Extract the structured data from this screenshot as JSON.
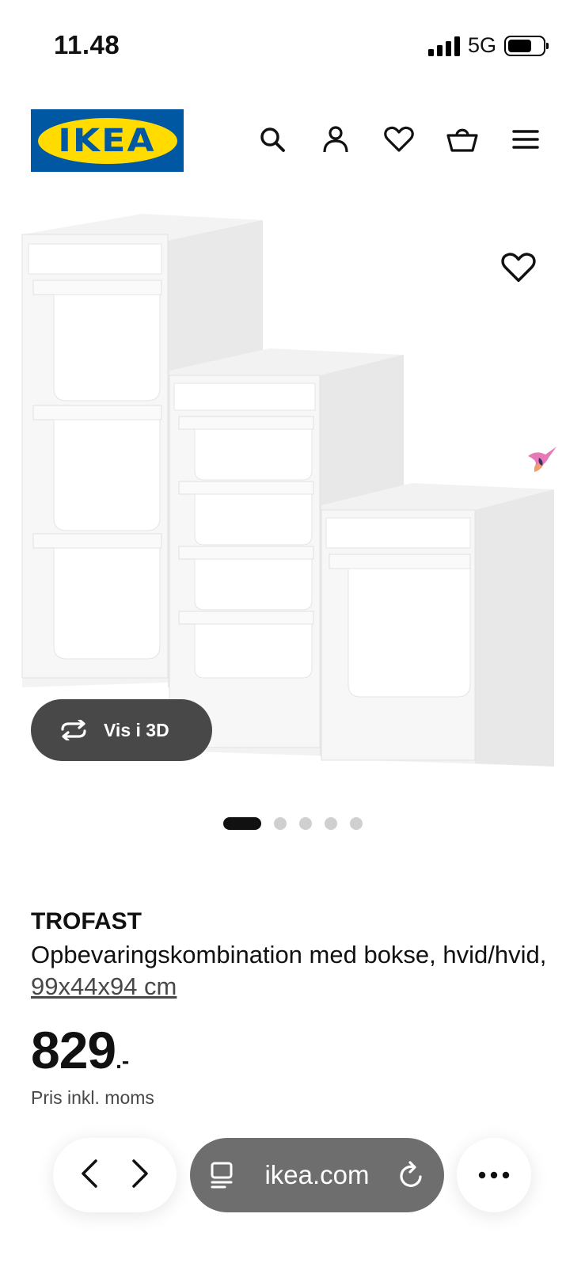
{
  "status_bar": {
    "time": "11.48",
    "network": "5G",
    "battery_level": 0.7
  },
  "header": {
    "logo_text": "IKEA",
    "icons": [
      "search-icon",
      "account-icon",
      "heart-icon",
      "basket-icon",
      "menu-icon"
    ]
  },
  "gallery": {
    "view_3d_label": "Vis i 3D",
    "image_count": 5,
    "active_index": 0
  },
  "product": {
    "name": "TROFAST",
    "description": "Opbevaringskombination med bokse, hvid/hvid,",
    "dimensions": "99x44x94 cm",
    "price_integer": "829",
    "price_suffix": ".-",
    "price_note": "Pris inkl. moms"
  },
  "browser": {
    "url": "ikea.com"
  },
  "colors": {
    "ikea_blue": "#0058a3",
    "ikea_yellow": "#ffdb00",
    "button_dark": "#484848"
  }
}
